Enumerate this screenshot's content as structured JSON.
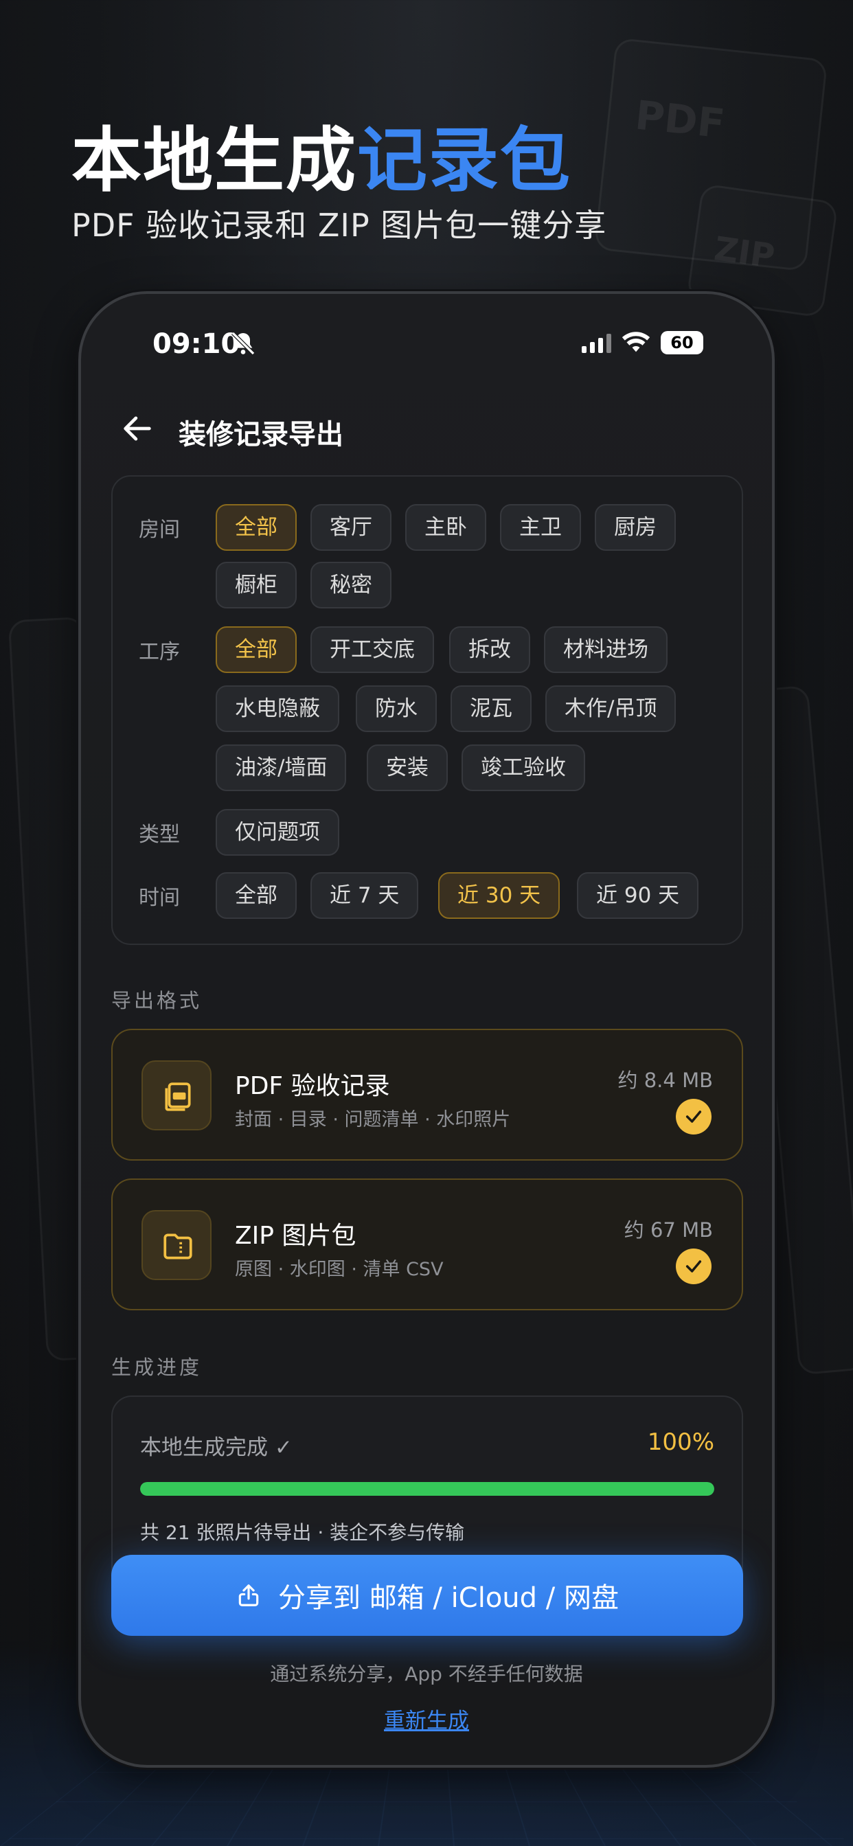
{
  "hero": {
    "title_plain": "本地生成",
    "title_accent": "记录包",
    "subtitle": "PDF 验收记录和 ZIP 图片包一键分享",
    "bg_doc_pdf": "PDF",
    "bg_doc_zip": "ZIP"
  },
  "status_bar": {
    "time": "09:10",
    "battery": "60"
  },
  "nav": {
    "title": "装修记录导出"
  },
  "filters": {
    "room": {
      "label": "房间",
      "options": [
        "全部",
        "客厅",
        "主卧",
        "主卫",
        "厨房",
        "橱柜",
        "秘密"
      ],
      "selected": "全部"
    },
    "process": {
      "label": "工序",
      "options": [
        "全部",
        "开工交底",
        "拆改",
        "材料进场",
        "水电隐蔽",
        "防水",
        "泥瓦",
        "木作/吊顶",
        "油漆/墙面",
        "安装",
        "竣工验收"
      ],
      "selected": "全部"
    },
    "type": {
      "label": "类型",
      "options": [
        "仅问题项"
      ]
    },
    "time": {
      "label": "时间",
      "options": [
        "全部",
        "近 7 天",
        "近 30 天",
        "近 90 天"
      ],
      "selected": "近 30 天"
    }
  },
  "export_format": {
    "label": "导出格式",
    "items": [
      {
        "title": "PDF 验收记录",
        "desc": "封面 · 目录 · 问题清单 · 水印照片",
        "size": "约 8.4 MB",
        "checked": true,
        "icon": "pdf-document-icon"
      },
      {
        "title": "ZIP 图片包",
        "desc": "原图 · 水印图 · 清单 CSV",
        "size": "约 67 MB",
        "checked": true,
        "icon": "zip-folder-icon"
      }
    ]
  },
  "progress": {
    "label": "生成进度",
    "status": "本地生成完成 ✓",
    "percent_text": "100%",
    "percent": 100,
    "note": "共 21 张照片待导出 · 装企不参与传输"
  },
  "share_button": {
    "label": "分享到 邮箱 / iCloud / 网盘"
  },
  "footer": {
    "note": "通过系统分享，App 不经手任何数据",
    "regenerate": "重新生成"
  },
  "colors": {
    "accent_blue": "#3b86f2",
    "accent_gold": "#f3c043",
    "progress_green": "#35c759"
  }
}
